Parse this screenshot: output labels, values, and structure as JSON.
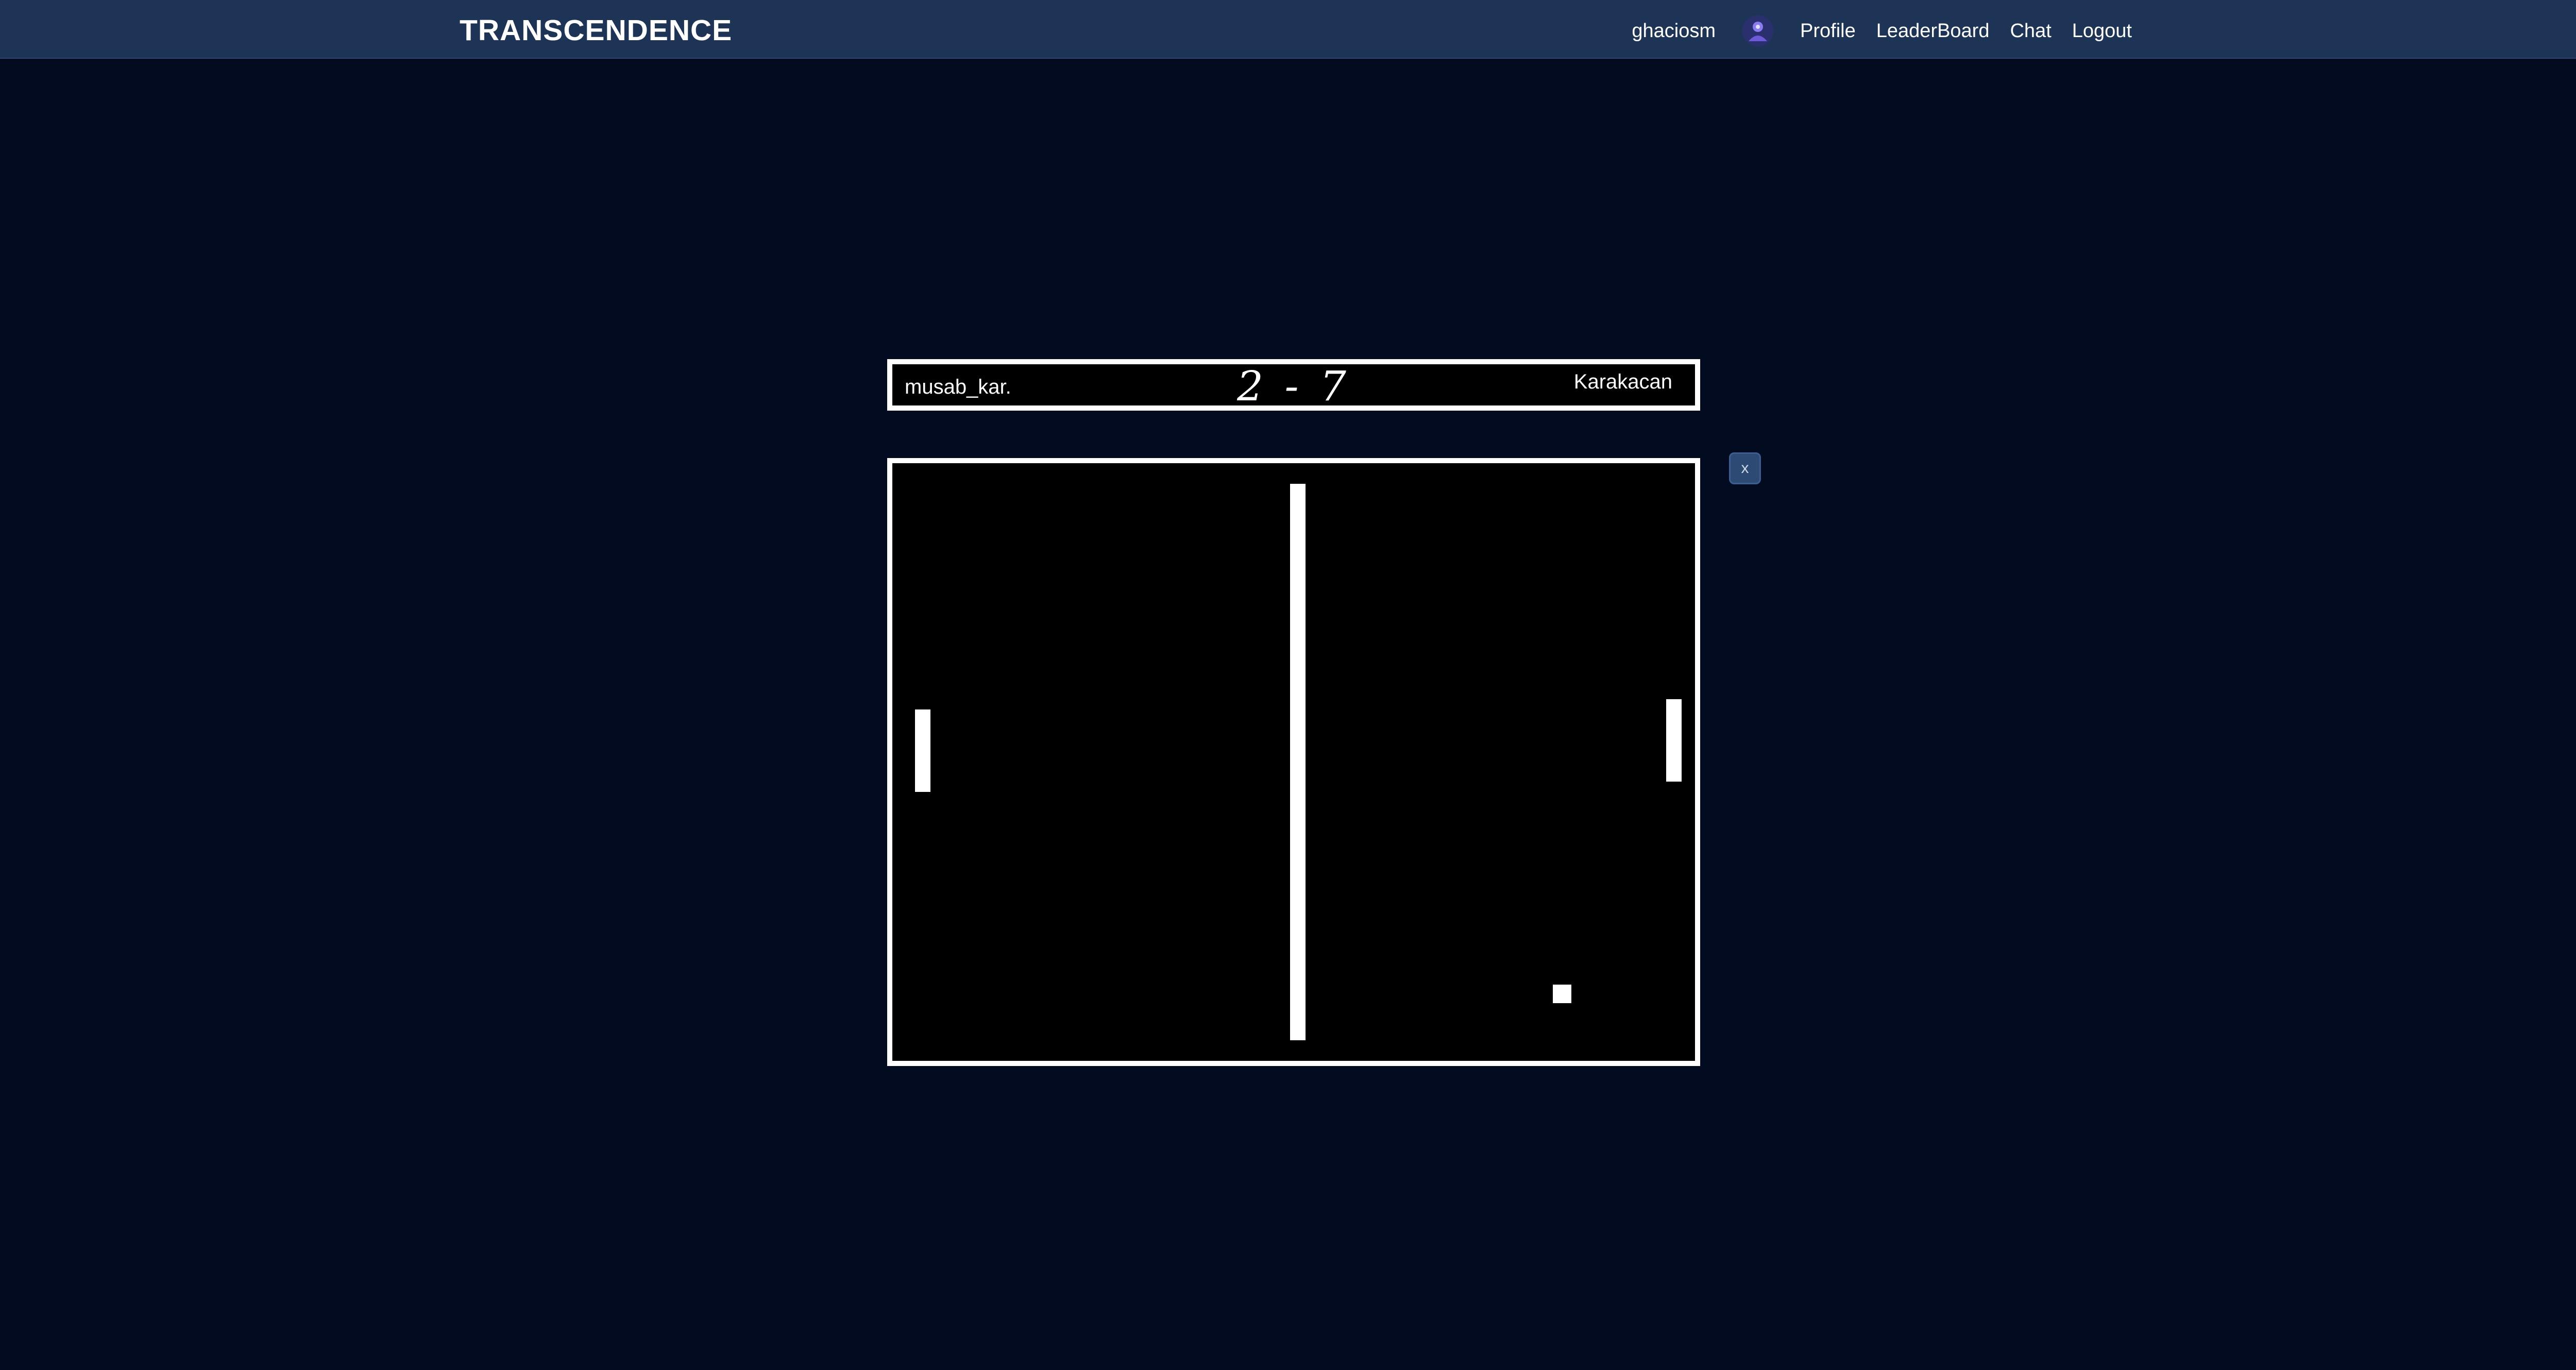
{
  "header": {
    "brand": "TRANSCENDENCE",
    "username": "ghaciosm",
    "nav": {
      "profile": "Profile",
      "leaderboard": "LeaderBoard",
      "chat": "Chat",
      "logout": "Logout"
    }
  },
  "game": {
    "player_left": "musab_kar.",
    "player_right": "Karakacan",
    "score_text": "2 - 7",
    "close_label": "x"
  },
  "colors": {
    "background": "#030b21",
    "topbar": "#1e3457",
    "field": "#000000",
    "lines": "#ffffff"
  }
}
